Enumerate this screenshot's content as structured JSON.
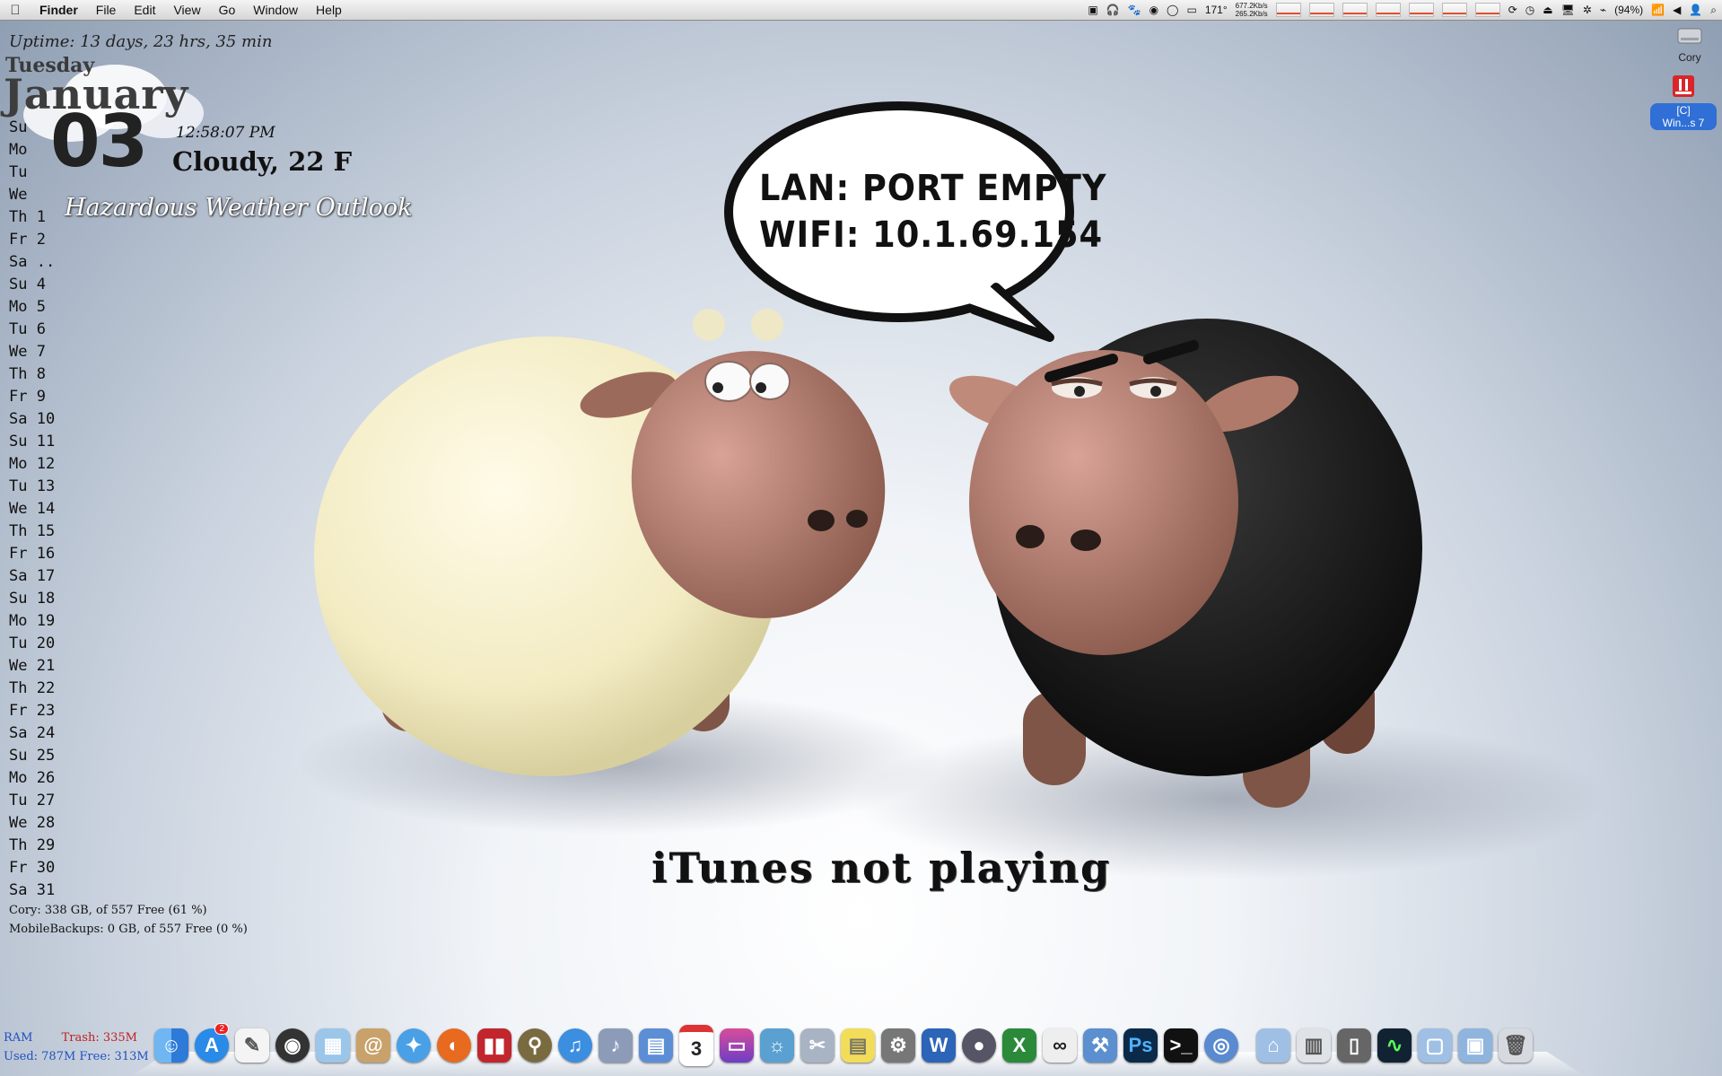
{
  "menubar": {
    "app_name": "Finder",
    "menus": [
      "File",
      "Edit",
      "View",
      "Go",
      "Window",
      "Help"
    ],
    "temperature": "171°",
    "net_up": "677.2Kb/s",
    "net_down": "265.2Kb/s",
    "battery": "(94%)"
  },
  "widgets": {
    "uptime": "Uptime: 13 days, 23 hrs, 35 min",
    "day_name": "Tuesday",
    "month": "January",
    "day_number": "03",
    "clock": "12:58:07 PM",
    "weather": "Cloudy, 22 F",
    "weather_alert": "Hazardous Weather Outlook"
  },
  "calendar": [
    "Su",
    "Mo",
    "Tu",
    "We",
    "Th 1",
    "Fr 2",
    "Sa ..",
    "Su 4",
    "Mo 5",
    "Tu 6",
    "We 7",
    "Th 8",
    "Fr 9",
    "Sa 10",
    "Su 11",
    "Mo 12",
    "Tu 13",
    "We 14",
    "Th 15",
    "Fr 16",
    "Sa 17",
    "Su 18",
    "Mo 19",
    "Tu 20",
    "We 21",
    "Th 22",
    "Fr 23",
    "Sa 24",
    "Su 25",
    "Mo 26",
    "Tu 27",
    "We 28",
    "Th 29",
    "Fr 30",
    "Sa 31"
  ],
  "disks": {
    "line1": "Cory: 338 GB, of 557 Free (61 %)",
    "line2": "MobileBackups: 0 GB, of 557 Free (0 %)"
  },
  "speech": {
    "line1": "LAN: PORT EMPTY",
    "line2": "WIFI: 10.1.69.154"
  },
  "now_playing": "iTunes not playing",
  "desktop_icons": {
    "drive_label": "Cory",
    "win_label_1": "[C]",
    "win_label_2": "Win...s 7"
  },
  "memory": {
    "ram_label": "RAM",
    "trash": "Trash: 335M",
    "used": "Used: 787M Free: 313M"
  },
  "dock": {
    "appstore_badge": "2",
    "calendar_day": "3",
    "ps_label": "Ps",
    "word_label": "W",
    "excel_label": "X"
  },
  "colors": {
    "wallpaper_center": "#ffffff",
    "wallpaper_edge": "#8e9db2",
    "alert_text": "#ffffff",
    "ram_blue": "#2050c0",
    "trash_red": "#c02020"
  }
}
